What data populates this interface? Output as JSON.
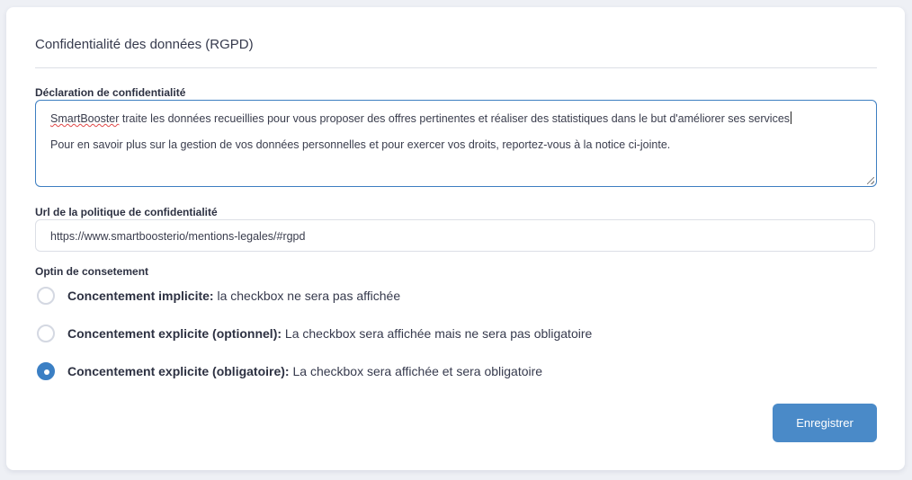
{
  "section": {
    "title": "Confidentialité des données (RGPD)"
  },
  "privacy_statement": {
    "label": "Déclaration de confidentialité",
    "word_flagged": "SmartBooster",
    "line1_rest": " traite les données recueillies pour vous proposer des offres pertinentes et réaliser des statistiques dans le but d'améliorer ses services",
    "line2": "Pour en savoir plus sur la gestion de vos données personnelles et pour exercer vos droits, reportez-vous à la notice ci-jointe."
  },
  "policy_url": {
    "label": "Url de la politique de confidentialité",
    "value": "https://www.smartboosterio/mentions-legales/#rgpd"
  },
  "consent": {
    "label": "Optin de consetement",
    "options": [
      {
        "title": "Concentement implicite:",
        "desc": " la checkbox ne sera pas affichée",
        "selected": false
      },
      {
        "title": "Concentement explicite (optionnel):",
        "desc": " La checkbox sera affichée mais ne sera pas obligatoire",
        "selected": false
      },
      {
        "title": "Concentement explicite (obligatoire):",
        "desc": " La checkbox sera affichée et sera obligatoire",
        "selected": true
      }
    ]
  },
  "actions": {
    "save_label": "Enregistrer"
  },
  "colors": {
    "accent": "#3b7fc4",
    "button": "#4a8ac8"
  }
}
